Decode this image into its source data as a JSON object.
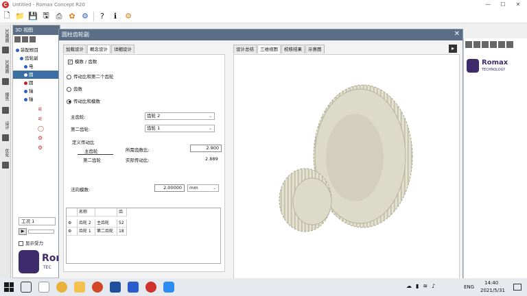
{
  "window": {
    "title": "Untitled - Romax Concept R20"
  },
  "panel3d": {
    "title": "3D 视图",
    "tree": [
      "装配根目",
      "齿轮副",
      "电",
      "圆",
      "圆",
      "轴",
      "轴"
    ]
  },
  "vstrip": {
    "tabs": [
      "3D视图",
      "3D视图",
      "报告",
      "设计",
      "优化"
    ]
  },
  "dialog": {
    "title": "圆柱齿轮副",
    "tabs": [
      "加载设计",
      "概念设计",
      "详细设计"
    ],
    "active_tab": 1,
    "form": {
      "modulus_teeth_label": "模数 / 齿数",
      "radio_options": [
        "传动比和第二个齿轮",
        "齿数",
        "传动比和模数"
      ],
      "selected_radio": 2,
      "main_gear_label": "主齿轮:",
      "main_gear_value": "齿轮 2",
      "second_gear_label": "第二齿轮:",
      "second_gear_value": "齿轮 1",
      "define_ratio_label": "定义传动比",
      "ratio_main": "主齿轮",
      "ratio_second": "第二齿轮",
      "required_ratio_label": "所需齿数比:",
      "required_ratio_value": "2.900",
      "actual_ratio_label": "实际传动比:",
      "actual_ratio_value": "2.889",
      "normal_module_label": "法向模数:",
      "normal_module_value": "2.00000",
      "unit": "mm"
    },
    "table": {
      "headers": [
        "名称",
        "",
        "齿"
      ],
      "rows": [
        {
          "name": "齿轮 2",
          "role": "主齿轮",
          "teeth": "52"
        },
        {
          "name": "齿轮 1",
          "role": "第二齿轮",
          "teeth": "18"
        }
      ]
    },
    "right_tabs": [
      "设计总结",
      "三维视图",
      "校核结果",
      "示意图"
    ],
    "active_right_tab": 1
  },
  "loadcase": {
    "label": "工况 1",
    "show_force": "显示受力"
  },
  "brand": {
    "romax": "Romax",
    "technology": "TECHNOLOGY",
    "tec": "TEC"
  },
  "taskbar": {
    "lang": "ENG",
    "time": "14:40",
    "date": "2021/5/31"
  },
  "colors": {
    "title_bar_blue": "#5a6f86",
    "gear": "#d8d6c4",
    "taskbar": "#e6e9ee"
  }
}
